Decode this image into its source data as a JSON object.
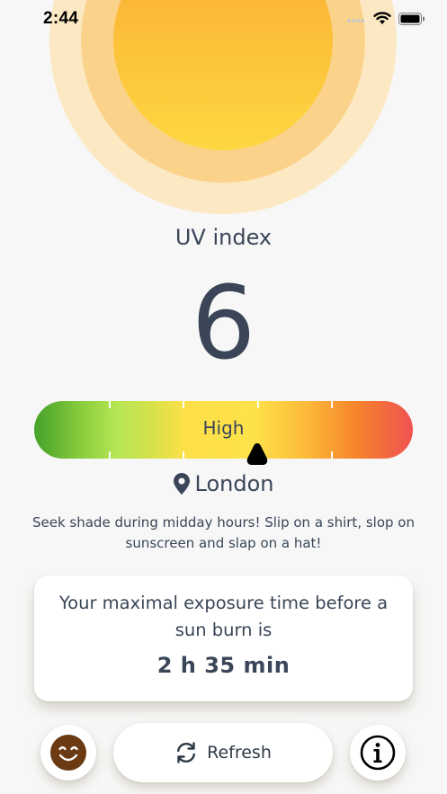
{
  "status_bar": {
    "time": "2:44",
    "icons": [
      "signal-icon",
      "wifi-icon",
      "battery-icon"
    ]
  },
  "uv": {
    "title": "UV index",
    "value": "6",
    "level": "High",
    "scale_position_fraction": 0.59
  },
  "location": {
    "icon": "location-pin-icon",
    "name": "London"
  },
  "advice": "Seek shade during midday hours! Slip on a shirt, slop on sunscreen and slap on a hat!",
  "exposure": {
    "text": "Your maximal exposure time before a sun burn is",
    "time": "2 h 35 min"
  },
  "actions": {
    "mood_icon": "smiley-face-icon",
    "refresh_icon": "refresh-icon",
    "refresh_label": "Refresh",
    "info_icon": "info-icon"
  },
  "colors": {
    "text": "#3a4658",
    "sun_core": "#fcc13a",
    "sun_ring_inner": "#fbd28a",
    "sun_ring_outer": "#fce9c3",
    "scale_low": "#46a22a",
    "scale_high": "#ef5252",
    "mood": "#6b3a12"
  }
}
